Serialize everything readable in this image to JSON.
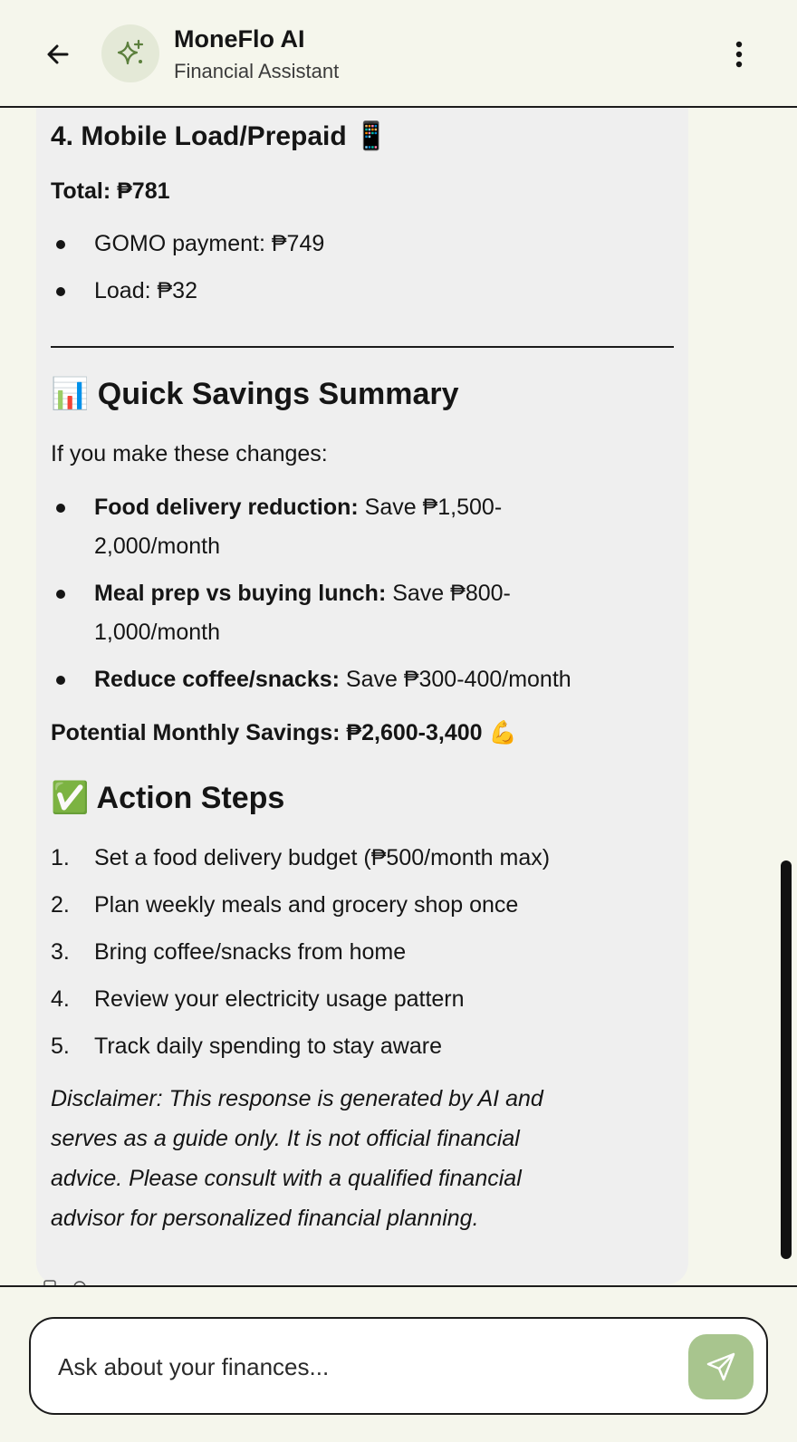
{
  "header": {
    "title": "MoneFlo AI",
    "subtitle": "Financial Assistant",
    "back_icon": "arrow-left-icon",
    "avatar_icon": "sparkle-icon",
    "menu_icon": "more-vertical-icon"
  },
  "message": {
    "mobile_section": {
      "heading": "4. Mobile Load/Prepaid 📱",
      "total": "Total: ₱781",
      "items": [
        "GOMO payment: ₱749",
        "Load: ₱32"
      ]
    },
    "savings_summary": {
      "heading": "📊 Quick Savings Summary",
      "intro": "If you make these changes:",
      "items": [
        {
          "label": "Food delivery reduction:",
          "line1": " Save ₱1,500-",
          "line2": "2,000/month"
        },
        {
          "label": "Meal prep vs buying lunch:",
          "line1": " Save ₱800-",
          "line2": "1,000/month"
        },
        {
          "label": "Reduce coffee/snacks:",
          "line1": " Save ₱300-400/month",
          "line2": ""
        }
      ],
      "potential": "Potential Monthly Savings: ₱2,600-3,400 💪"
    },
    "action_steps": {
      "heading": "✅ Action Steps",
      "steps": [
        "Set a food delivery budget (₱500/month max)",
        "Plan weekly meals and grocery shop once",
        "Bring coffee/snacks from home",
        "Review your electricity usage pattern",
        "Track daily spending to stay aware"
      ]
    },
    "disclaimer": [
      "Disclaimer: This response is generated by AI and",
      "serves as a guide only. It is not official financial",
      "advice. Please consult with a qualified financial",
      "advisor for personalized financial planning."
    ]
  },
  "composer": {
    "placeholder": "Ask about your finances...",
    "send_icon": "send-icon"
  },
  "colors": {
    "background": "#f5f6ec",
    "bubble": "#efefef",
    "accent": "#a8c58e",
    "avatar_bg": "#e4e9d7",
    "text": "#151515"
  }
}
